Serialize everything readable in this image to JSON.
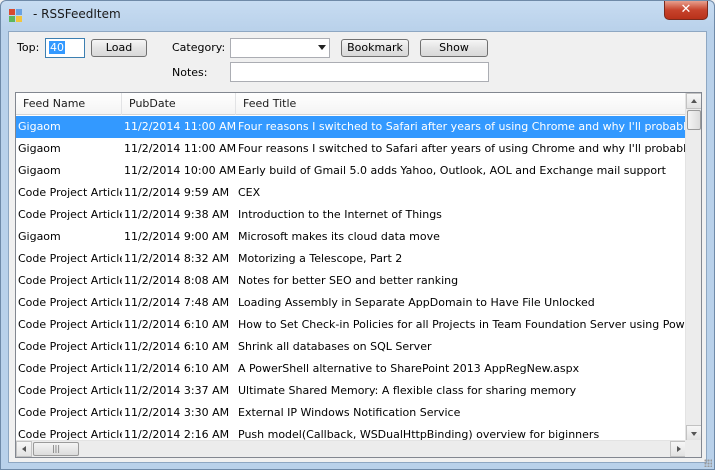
{
  "window": {
    "title": " - RSSFeedItem",
    "close_glyph": "✕"
  },
  "toolbar": {
    "top_label": "Top:",
    "top_value": "40",
    "load_label": "Load",
    "category_label": "Category:",
    "category_value": "",
    "bookmark_label": "Bookmark",
    "show_label": "Show",
    "notes_label": "Notes:",
    "notes_value": ""
  },
  "list": {
    "columns": [
      "Feed Name",
      "PubDate",
      "Feed Title"
    ],
    "selected_index": 0,
    "rows": [
      {
        "feed": "Gigaom",
        "date": "11/2/2014 11:00 AM",
        "title": "Four reasons I switched to Safari after years of using Chrome and why I'll probably switch back"
      },
      {
        "feed": "Gigaom",
        "date": "11/2/2014 11:00 AM",
        "title": "Four reasons I switched to Safari after years of using Chrome and why I'll probably switch back"
      },
      {
        "feed": "Gigaom",
        "date": "11/2/2014 10:00 AM",
        "title": "Early build of Gmail 5.0 adds Yahoo, Outlook, AOL and Exchange mail support"
      },
      {
        "feed": "Code Project Articles",
        "date": "11/2/2014 9:59 AM",
        "title": "CEX"
      },
      {
        "feed": "Code Project Articles",
        "date": "11/2/2014 9:38 AM",
        "title": "Introduction to the Internet of Things"
      },
      {
        "feed": "Gigaom",
        "date": "11/2/2014 9:00 AM",
        "title": "Microsoft makes its cloud data move"
      },
      {
        "feed": "Code Project Articles",
        "date": "11/2/2014 8:32 AM",
        "title": "Motorizing a Telescope, Part 2"
      },
      {
        "feed": "Code Project Articles",
        "date": "11/2/2014 8:08 AM",
        "title": "Notes for better SEO and better ranking"
      },
      {
        "feed": "Code Project Articles",
        "date": "11/2/2014 7:48 AM",
        "title": "Loading Assembly in Separate AppDomain to Have File Unlocked"
      },
      {
        "feed": "Code Project Articles",
        "date": "11/2/2014 6:10 AM",
        "title": "How to Set Check-in Policies for all Projects in Team Foundation Server using PowerShell?"
      },
      {
        "feed": "Code Project Articles",
        "date": "11/2/2014 6:10 AM",
        "title": "Shrink all databases on SQL Server"
      },
      {
        "feed": "Code Project Articles",
        "date": "11/2/2014 6:10 AM",
        "title": "A PowerShell alternative to SharePoint 2013 AppRegNew.aspx"
      },
      {
        "feed": "Code Project Articles",
        "date": "11/2/2014 3:37 AM",
        "title": "Ultimate Shared Memory: A flexible class for sharing memory"
      },
      {
        "feed": "Code Project Articles",
        "date": "11/2/2014 3:30 AM",
        "title": "External IP Windows Notification Service"
      },
      {
        "feed": "Code Project Articles",
        "date": "11/2/2014 2:16 AM",
        "title": "Push model(Callback, WSDualHttpBinding) overview for biginners"
      }
    ]
  },
  "icons": {
    "app": "app-icon",
    "close": "close-icon",
    "dropdown": "chevron-down-icon"
  },
  "colors": {
    "selection": "#3399ff",
    "close_button": "#c7432c",
    "window_frame": "#b9d1ea"
  }
}
